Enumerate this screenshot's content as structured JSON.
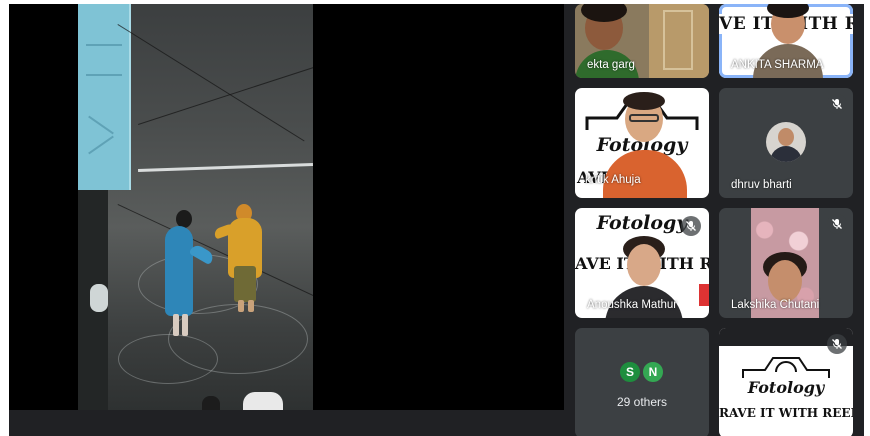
{
  "participants": [
    {
      "name": "ekta garg",
      "muted": false,
      "speaking": false
    },
    {
      "name": "ANKITA SHARMA",
      "muted": false,
      "speaking": true
    },
    {
      "name": "kritik Ahuja",
      "muted": false,
      "speaking": false
    },
    {
      "name": "dhruv bharti",
      "muted": true,
      "speaking": false
    },
    {
      "name": "Anoushka Mathur",
      "muted": true,
      "speaking": false
    },
    {
      "name": "Lakshika Chutani",
      "muted": true,
      "speaking": false
    }
  ],
  "backgrounds": {
    "fotology": "Fotology",
    "rave_banner_short": "AVE IT WITH REE",
    "rave_banner_ankita": "VE IT WITH REE",
    "rave_banner_kritik": "AVE IT",
    "rave_banner_anoushka": "AVE IT WITH REEI",
    "rave_banner_full": "RAVE IT WITH REELS"
  },
  "others": {
    "initials": [
      "S",
      "N"
    ],
    "label": "29 others"
  },
  "colors": {
    "meet_bg": "#202124",
    "tile_bg": "#3c4043",
    "active_border": "#8ab4f8",
    "avatar_s": "#1e8e3e",
    "avatar_n": "#34a853"
  },
  "icons": {
    "muted": "mic-off-icon",
    "lens": "camera-lens-icon"
  }
}
